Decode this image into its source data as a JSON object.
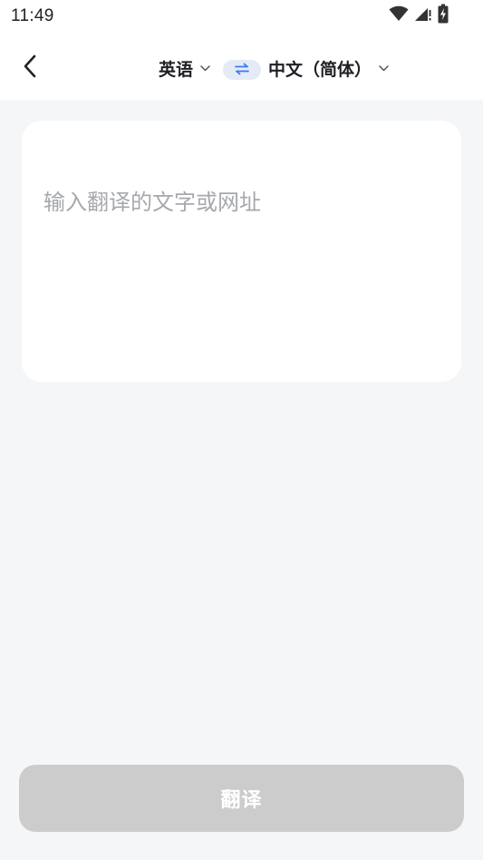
{
  "status_bar": {
    "time": "11:49",
    "icons": [
      "wifi-icon",
      "cellular-signal-icon",
      "battery-charging-icon"
    ]
  },
  "header": {
    "back_icon": "chevron-left-icon",
    "source_language": "英语",
    "target_language": "中文（简体）",
    "swap_icon": "swap-arrows-icon"
  },
  "editor": {
    "placeholder": "输入翻译的文字或网址",
    "value": ""
  },
  "footer": {
    "translate_label": "翻译"
  },
  "colors": {
    "page_background": "#F5F6F8",
    "card_background": "#FFFFFF",
    "button_disabled": "#CCCCCC",
    "swap_background": "#E4EBF6",
    "swap_accent": "#3B7BE8",
    "placeholder_text": "#A6A8AD"
  }
}
